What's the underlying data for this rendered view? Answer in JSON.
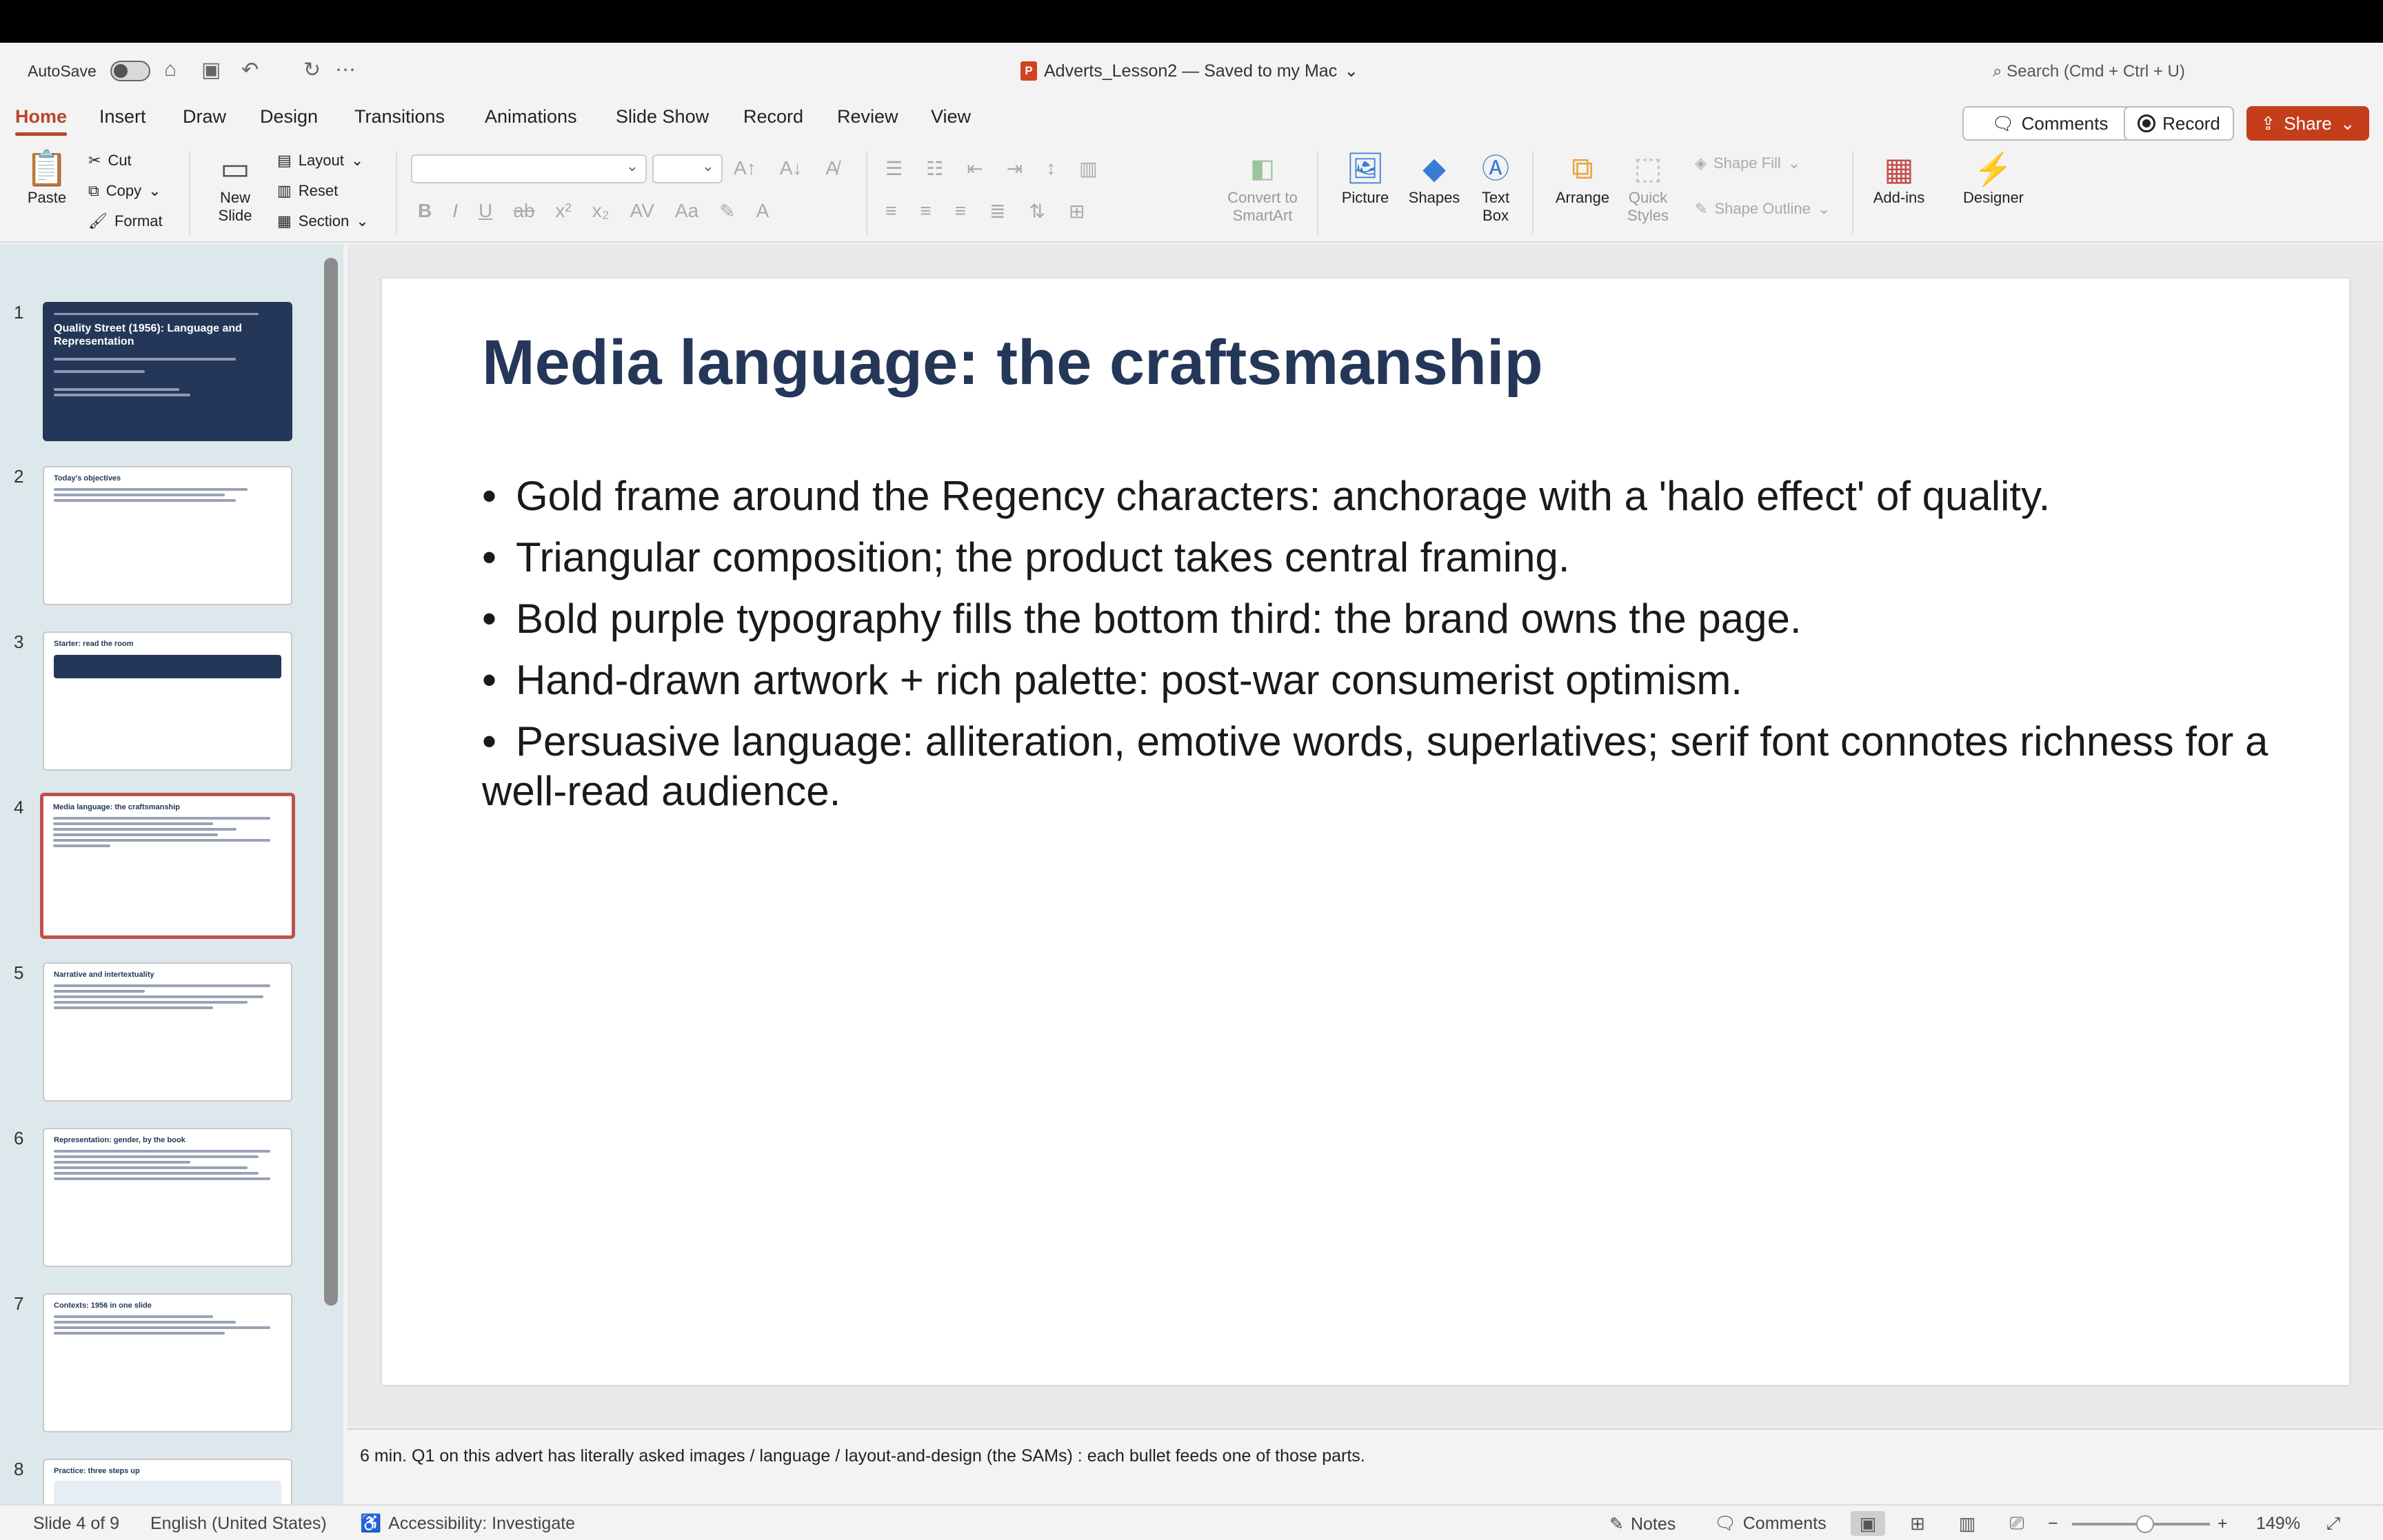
{
  "titlebar": {
    "autosave_label": "AutoSave",
    "doc_title": "Adverts_Lesson2 — Saved to my Mac",
    "search_placeholder": "Search (Cmd + Ctrl + U)"
  },
  "tabs": [
    "Home",
    "Insert",
    "Draw",
    "Design",
    "Transitions",
    "Animations",
    "Slide Show",
    "Record",
    "Review",
    "View"
  ],
  "actions": {
    "comments": "Comments",
    "record": "Record",
    "share": "Share"
  },
  "ribbon": {
    "paste": "Paste",
    "cut": "Cut",
    "copy": "Copy",
    "format": "Format",
    "new_slide": [
      "New",
      "Slide"
    ],
    "layout": "Layout",
    "reset": "Reset",
    "section": "Section",
    "convert": [
      "Convert to",
      "SmartArt"
    ],
    "picture": "Picture",
    "shapes": "Shapes",
    "text_box": [
      "Text",
      "Box"
    ],
    "arrange": "Arrange",
    "quick_styles": [
      "Quick",
      "Styles"
    ],
    "shape_fill": "Shape Fill",
    "shape_outline": "Shape Outline",
    "add_ins": "Add-ins",
    "designer": "Designer"
  },
  "thumbnails": [
    {
      "num": "1",
      "title": "Quality Street (1956): Language and Representation"
    },
    {
      "num": "2",
      "title": "Today's objectives"
    },
    {
      "num": "3",
      "title": "Starter: read the room"
    },
    {
      "num": "4",
      "title": "Media language: the craftsmanship"
    },
    {
      "num": "5",
      "title": "Narrative and intertextuality"
    },
    {
      "num": "6",
      "title": "Representation: gender, by the book"
    },
    {
      "num": "7",
      "title": "Contexts: 1956 in one slide"
    },
    {
      "num": "8",
      "title": "Practice: three steps up"
    }
  ],
  "slide": {
    "title": "Media language: the craftsmanship",
    "bullets": [
      "Gold frame around the Regency characters: anchorage with a 'halo effect' of quality.",
      "Triangular composition; the product takes central framing.",
      "Bold purple typography fills the bottom third: the brand owns the page.",
      "Hand-drawn artwork + rich palette: post-war consumerist optimism.",
      "Persuasive language: alliteration, emotive words, superlatives; serif font connotes richness for a well-read audience."
    ]
  },
  "notes": "6 min. Q1 on this advert has literally asked images / language / layout-and-design (the SAMs) : each bullet feeds one of those parts.",
  "status": {
    "slide_of": "Slide 4 of 9",
    "language": "English (United States)",
    "accessibility": "Accessibility: Investigate",
    "notes": "Notes",
    "comments": "Comments",
    "zoom": "149%"
  },
  "colors": {
    "accent": "#b7472a",
    "share": "#c43e1c",
    "title": "#253758"
  }
}
